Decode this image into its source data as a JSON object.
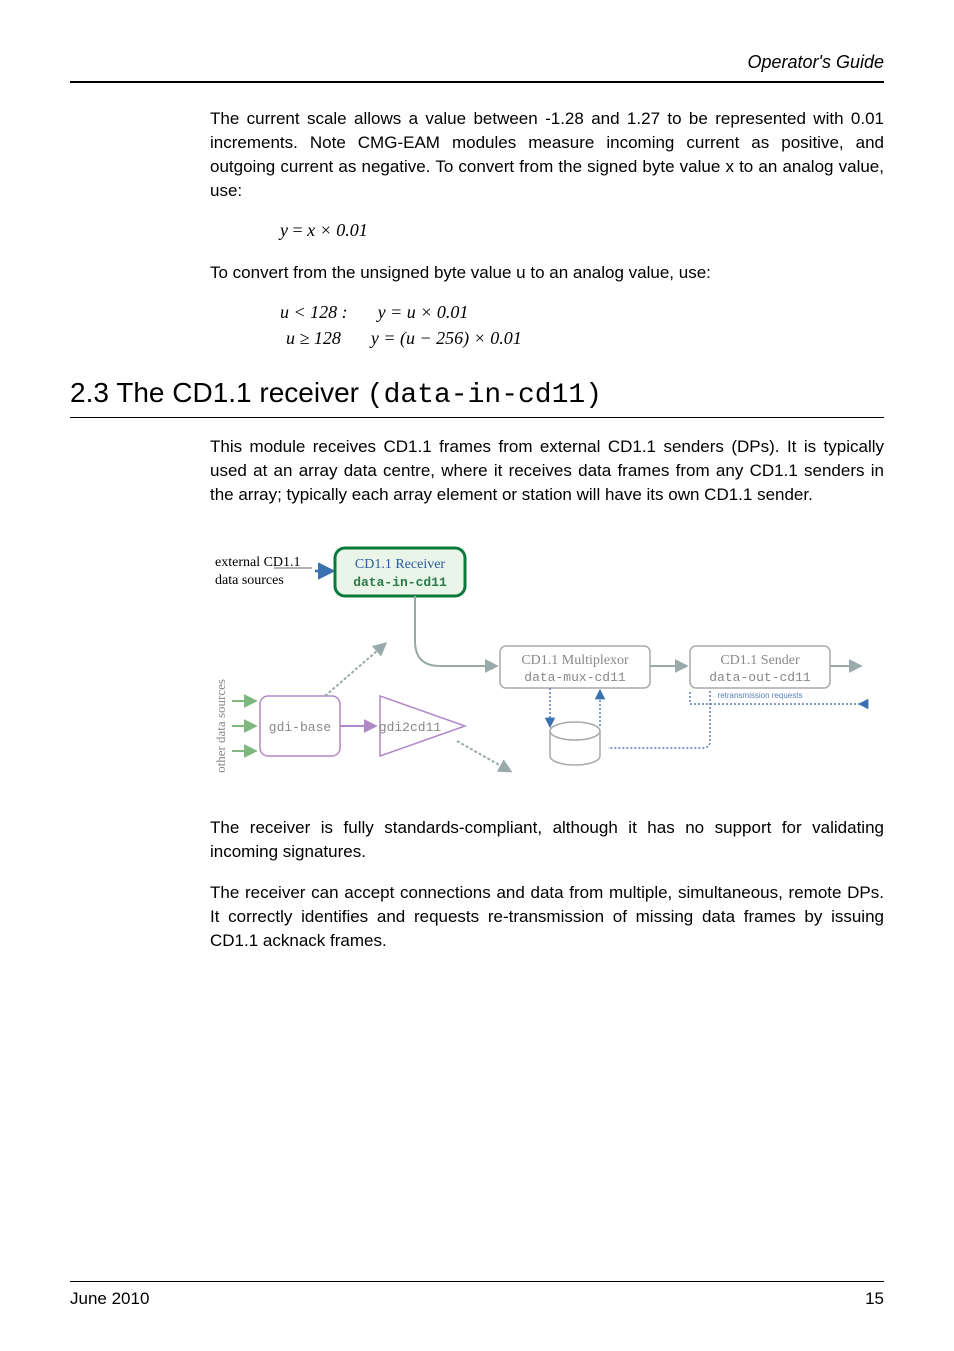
{
  "header": "Operator's Guide",
  "para1": "The current scale allows a value between -1.28 and 1.27 to be represented with 0.01 increments. Note CMG-EAM modules measure incoming current as positive, and outgoing current as negative. To convert from the signed byte value x to an analog value, use:",
  "formula1_lhs": "y",
  "formula1_rhs": "x × 0.01",
  "para2": "To convert from the unsigned byte value u to an analog value, use:",
  "formula2_line1_cond": "u < 128 :",
  "formula2_line1_expr": "y = u × 0.01",
  "formula2_line2_cond": "u ≥ 128",
  "formula2_line2_expr": "y = (u − 256) × 0.01",
  "section_number": "2.3",
  "section_title_text": "The CD1.1 receiver",
  "section_title_code": "(data-in-cd11)",
  "para3": "This module receives CD1.1 frames from external CD1.1 senders (DPs).  It is typically used at an array data centre, where it receives data frames from any CD1.1 senders in the array; typically each array element or station will have its own CD1.1 sender.",
  "diagram": {
    "external_label_line1": "external CD1.1",
    "external_label_line2": "data sources",
    "receiver_line1": "CD1.1 Receiver",
    "receiver_line2": "data-in-cd11",
    "mux_line1": "CD1.1 Multiplexor",
    "mux_line2": "data-mux-cd11",
    "sender_line1": "CD1.1 Sender",
    "sender_line2": "data-out-cd11",
    "retransmission": "retransmission requests",
    "other_sources": "other data sources",
    "gdi_base": "gdi-base",
    "gdi2cd11": "gdi2cd11"
  },
  "para4": "The receiver is fully standards-compliant, although it has no support for validating incoming signatures.",
  "para5": "The receiver can accept connections and data from multiple, simultaneous, remote DPs. It correctly identifies and requests re-transmission of missing data frames by issuing CD1.1 acknack frames.",
  "footer_left": "June 2010",
  "footer_right": "15"
}
